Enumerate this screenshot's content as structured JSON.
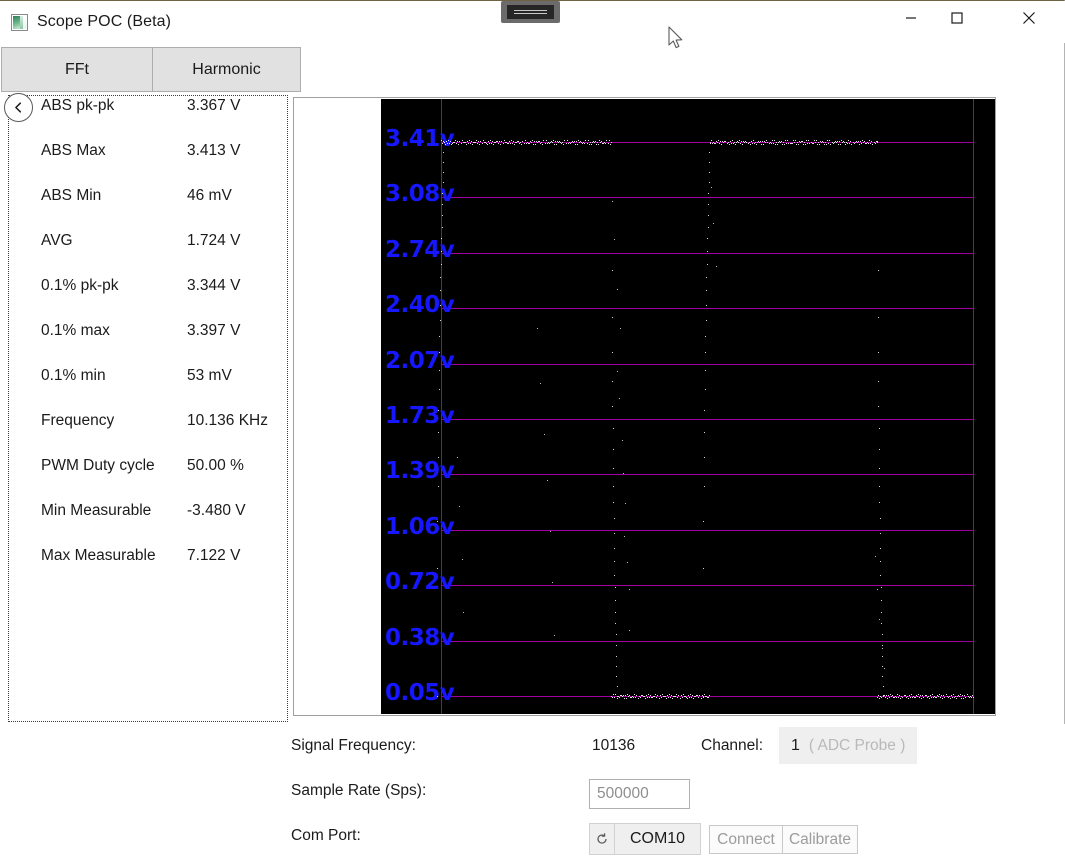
{
  "window": {
    "title": "Scope POC (Beta)",
    "icon": "app-scope-icon",
    "minimize_label": "—",
    "maximize_label": "□",
    "close_label": "✕",
    "snap_overlay": "drag-snap-overlay"
  },
  "tabs": [
    {
      "id": "fft",
      "label": "FFt"
    },
    {
      "id": "harmonic",
      "label": "Harmonic"
    }
  ],
  "back_button": {
    "icon": "chevron-left-icon"
  },
  "measurements": [
    {
      "label": "ABS pk-pk",
      "value": "3.367 V"
    },
    {
      "label": "ABS Max",
      "value": "3.413 V"
    },
    {
      "label": "ABS Min",
      "value": "46 mV"
    },
    {
      "label": "AVG",
      "value": "1.724 V"
    },
    {
      "label": "0.1% pk-pk",
      "value": "3.344 V"
    },
    {
      "label": "0.1% max",
      "value": "3.397 V"
    },
    {
      "label": "0.1% min",
      "value": "53 mV"
    },
    {
      "label": "Frequency",
      "value": "10.136 KHz"
    },
    {
      "label": "PWM Duty cycle",
      "value": "50.00 %"
    },
    {
      "label": "Min Measurable",
      "value": "-3.480 V"
    },
    {
      "label": "Max Measurable",
      "value": "7.122 V"
    }
  ],
  "chart_data": {
    "type": "line",
    "title": "",
    "xlabel": "",
    "ylabel": "",
    "background": "#000000",
    "grid": true,
    "grid_color": "#a000a0",
    "trace_color": "#ffffff",
    "tick_color": "#1616ff",
    "ylim": [
      0.05,
      3.41
    ],
    "ytick_labels": [
      "3.41v",
      "3.08v",
      "2.74v",
      "2.40v",
      "2.07v",
      "1.73v",
      "1.39v",
      "1.06v",
      "0.72v",
      "0.38v",
      "0.05v"
    ],
    "ytick_values": [
      3.41,
      3.08,
      2.74,
      2.4,
      2.07,
      1.73,
      1.39,
      1.06,
      0.72,
      0.38,
      0.05
    ],
    "xtick_labels": [],
    "description": "Dotted square-wave / PWM capture, 50% duty cycle at 10.136 KHz, high level ~3.41 V and low level ~0.05 V",
    "series": [
      {
        "name": "ADC Probe Channel 1",
        "high_level": 3.41,
        "low_level": 0.05,
        "duty_cycle_pct": 50.0,
        "edges_x_pct": [
          0.5,
          32.0,
          50.5,
          82.0
        ],
        "edge_types": [
          "rise",
          "fall",
          "rise",
          "fall"
        ]
      }
    ]
  },
  "controls": {
    "signal_frequency_label": "Signal Frequency:",
    "signal_frequency_value": "10136",
    "channel_label": "Channel:",
    "channel_value": "1",
    "channel_hint": "( ADC Probe )",
    "sample_rate_label": "Sample Rate (Sps):",
    "sample_rate_value": "500000",
    "com_port_label": "Com Port:",
    "com_port_value": "COM10",
    "com_refresh_icon": "refresh-icon",
    "connect_label": "Connect",
    "calibrate_label": "Calibrate"
  }
}
